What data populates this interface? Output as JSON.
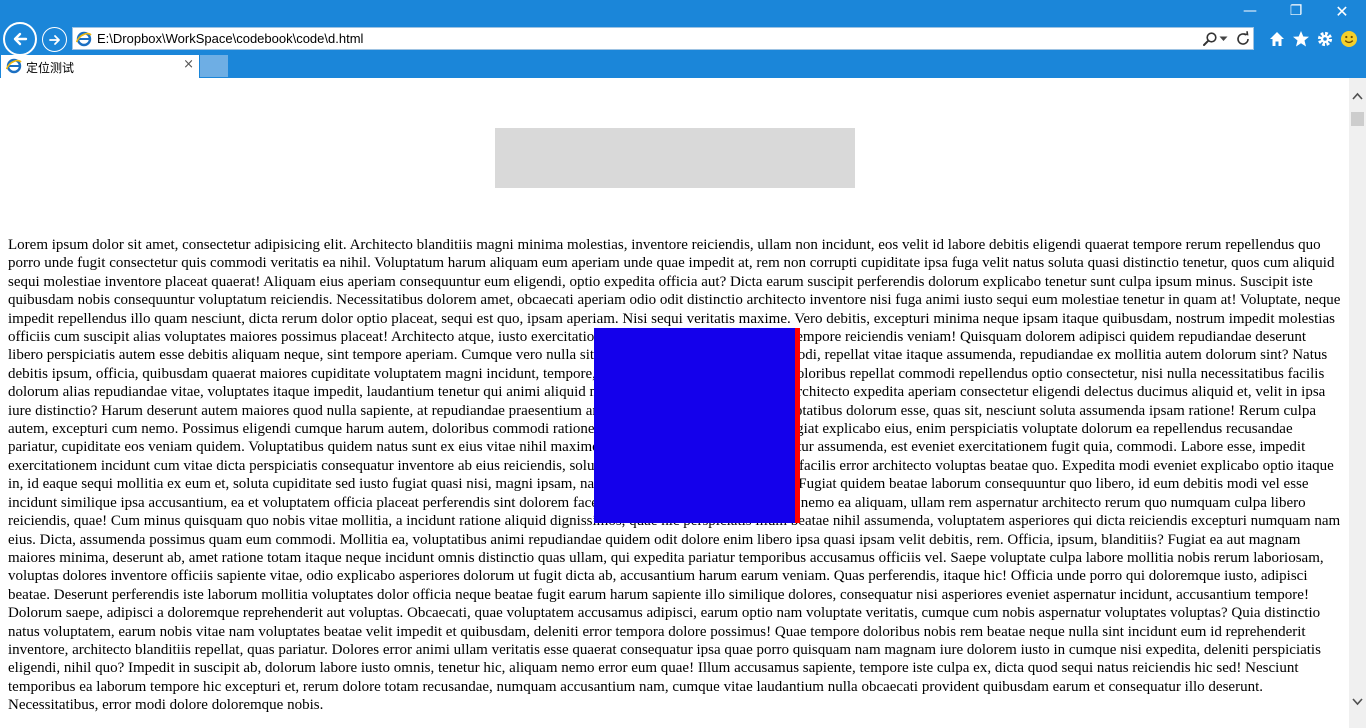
{
  "window": {
    "minimize_glyph": "—",
    "restore_glyph": "❐",
    "close_glyph": "✕"
  },
  "address_bar": {
    "url": "E:\\Dropbox\\WorkSpace\\codebook\\code\\d.html"
  },
  "tab": {
    "title": "定位测试",
    "close_glyph": "×"
  },
  "colors": {
    "chrome": "#1b86d9",
    "blue_box": "#0000ff",
    "red_box": "#ff0000",
    "gray_box": "#d9d9d9"
  },
  "page": {
    "body_text": "Lorem ipsum dolor sit amet, consectetur adipisicing elit. Architecto blanditiis magni minima molestias, inventore reiciendis, ullam non incidunt, eos velit id labore debitis eligendi quaerat tempore rerum repellendus quo porro unde fugit consectetur quis commodi veritatis ea nihil. Voluptatum harum aliquam eum aperiam unde quae impedit at, rem non corrupti cupiditate ipsa fuga velit natus soluta quasi distinctio tenetur, quos cum aliquid sequi molestiae inventore placeat quaerat! Aliquam eius aperiam consequuntur eum eligendi, optio expedita officia aut? Dicta earum suscipit perferendis dolorum explicabo tenetur sunt culpa ipsum minus. Suscipit iste quibusdam nobis consequuntur voluptatum reiciendis. Necessitatibus dolorem amet, obcaecati aperiam odio odit distinctio architecto inventore nisi fuga animi iusto sequi eum molestiae tenetur in quam at! Voluptate, neque impedit repellendus illo quam nesciunt, dicta rerum dolor optio placeat, sequi est quo, ipsam aperiam. Nisi sequi veritatis maxime. Vero debitis, excepturi minima neque ipsam itaque quibusdam, nostrum impedit molestias officiis cum suscipit alias voluptates maiores possimus placeat! Architecto atque, iusto exercitationem nam minima magni quaerat tempore reiciendis veniam! Quisquam dolorem adipisci quidem repudiandae deserunt libero perspiciatis autem esse debitis aliquam neque, sint tempore aperiam. Cumque vero nulla sit sed, eveniet velit similique eos modi, repellat vitae itaque assumenda, repudiandae ex mollitia autem dolorum sint? Natus debitis ipsum, officia, quibusdam quaerat maiores cupiditate voluptatem magni incidunt, tempore, nesciunt odit explicabo. Neque doloribus repellat commodi repellendus optio consectetur, nisi nulla necessitatibus facilis dolorum alias repudiandae vitae, voluptates itaque impedit, laudantium tenetur qui animi aliquid magnam. Minima harum tenetur, architecto expedita aperiam consectetur eligendi delectus ducimus aliquid et, velit in ipsa iure distinctio? Harum deserunt autem maiores quod nulla sapiente, at repudiandae praesentium amet reiciendis qui asperiores voluptatibus dolorum esse, quas sit, nesciunt soluta assumenda ipsam ratione! Rerum culpa autem, excepturi cum nemo. Possimus eligendi cumque harum autem, doloribus commodi ratione facere minima praesentium at, fugiat explicabo eius, enim perspiciatis voluptate dolorum ea repellendus recusandae pariatur, cupiditate eos veniam quidem. Voluptatibus quidem natus sunt ex eius vitae nihil maxime, suscipit error veritatis quas tenetur assumenda, est eveniet exercitationem fugit quia, commodi. Labore esse, impedit exercitationem incidunt cum vitae dicta perspiciatis consequatur inventore ab eius reiciendis, soluta, odio sequi harum dolorum eos facilis error architecto voluptas beatae quo. Expedita modi eveniet explicabo optio itaque in, id eaque sequi mollitia ex eum et, soluta cupiditate sed iusto fugiat quasi nisi, magni ipsam, natus reprehenderit nesciunt autem! Fugiat quidem beatae laborum consequuntur quo libero, id eum debitis modi vel esse incidunt similique ipsa accusantium, ea et voluptatem officia placeat perferendis sint dolorem facere saepe nobis aliquam! Nesciunt nemo ea aliquam, ullam rem aspernatur architecto rerum quo numquam culpa libero reiciendis, quae! Cum minus quisquam quo nobis vitae mollitia, a incidunt ratione aliquid dignissimos, quae hic perspiciatis illum beatae nihil assumenda, voluptatem asperiores qui dicta reiciendis excepturi numquam nam eius. Dicta, assumenda possimus quam eum commodi. Mollitia ea, voluptatibus animi repudiandae quidem odit dolore enim libero ipsa quasi ipsam velit debitis, rem. Officia, ipsum, blanditiis? Fugiat ea aut magnam maiores minima, deserunt ab, amet ratione totam itaque neque incidunt omnis distinctio quas ullam, qui expedita pariatur temporibus accusamus officiis vel. Saepe voluptate culpa labore mollitia nobis rerum laboriosam, voluptas dolores inventore officiis sapiente vitae, odio explicabo asperiores dolorum ut fugit dicta ab, accusantium harum earum veniam. Quas perferendis, itaque hic! Officia unde porro qui doloremque iusto, adipisci beatae. Deserunt perferendis iste laborum mollitia voluptates dolor officia neque beatae fugit earum harum sapiente illo similique dolores, consequatur nisi asperiores eveniet aspernatur incidunt, accusantium tempore! Dolorum saepe, adipisci a doloremque reprehenderit aut voluptas. Obcaecati, quae voluptatem accusamus adipisci, earum optio nam voluptate veritatis, cumque cum nobis aspernatur voluptates voluptas? Quia distinctio natus voluptatem, earum nobis vitae nam voluptates beatae velit impedit et quibusdam, deleniti error tempora dolore possimus! Quae tempore doloribus nobis rem beatae neque nulla sint incidunt eum id reprehenderit inventore, architecto blanditiis repellat, quas pariatur. Dolores error animi ullam veritatis esse quaerat consequatur ipsa quae porro quisquam nam magnam iure dolorem iusto in cumque nisi expedita, deleniti perspiciatis eligendi, nihil quo? Impedit in suscipit ab, dolorum labore iusto omnis, tenetur hic, aliquam nemo error eum quae! Illum accusamus sapiente, tempore iste culpa ex, dicta quod sequi natus reiciendis hic sed! Nesciunt temporibus ea laborum tempore hic excepturi et, rerum dolore totam recusandae, numquam accusantium nam, cumque vitae laudantium nulla obcaecati provident quibusdam earum et consequatur illo deserunt. Necessitatibus, error modi dolore doloremque nobis."
  }
}
